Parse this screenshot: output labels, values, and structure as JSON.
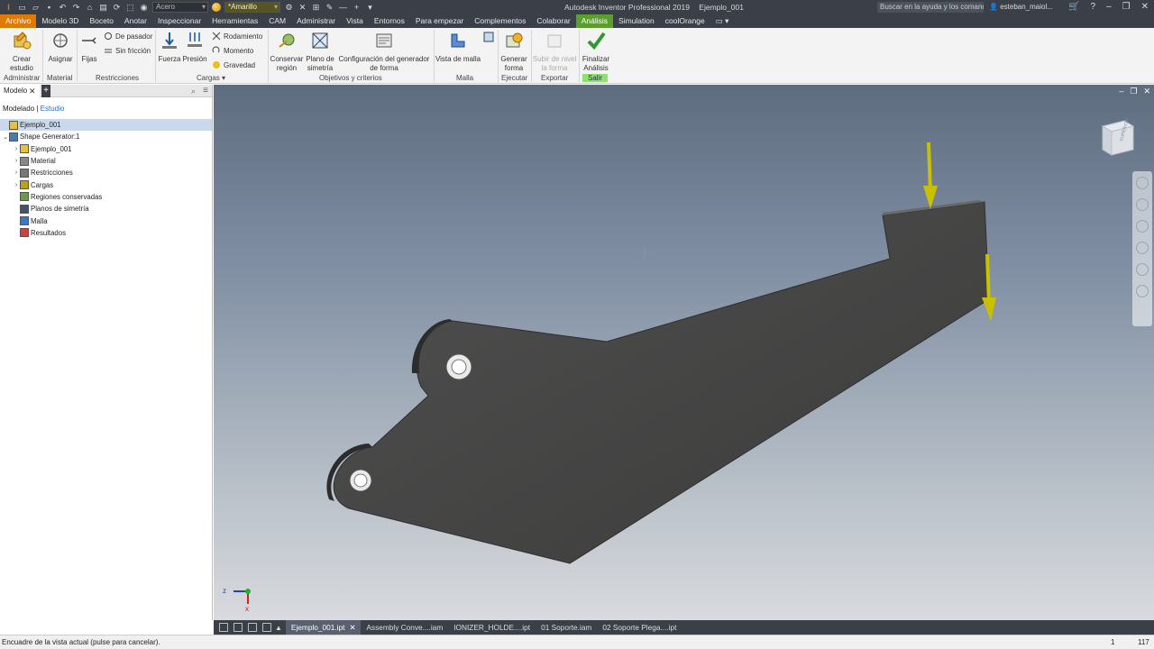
{
  "titlebar": {
    "material": "Acero",
    "appearance": "*Amarillo",
    "app_title": "Autodesk Inventor Professional 2019",
    "doc_title": "Ejemplo_001",
    "search_placeholder": "Buscar en la ayuda y los comandos...",
    "user": "esteban_maiol..."
  },
  "tabs": [
    "Archivo",
    "Modelo 3D",
    "Boceto",
    "Anotar",
    "Inspeccionar",
    "Herramientas",
    "CAM",
    "Administrar",
    "Vista",
    "Entornos",
    "Para empezar",
    "Complementos",
    "Colaborar",
    "Análisis",
    "Simulation",
    "coolOrange"
  ],
  "active_tab": "Análisis",
  "ribbon": {
    "crear_estudio": "Crear estudio",
    "asignar": "Asignar",
    "fijas": "Fijas",
    "de_pasador": "De pasador",
    "sin_friccion": "Sin fricción",
    "fuerza": "Fuerza",
    "presion": "Presión",
    "rodamiento": "Rodamiento",
    "momento": "Momento",
    "gravedad": "Gravedad",
    "conservar_region": "Conservar región",
    "plano_simetria": "Plano de simetría",
    "config_generador": "Configuración del generador de forma",
    "vista_malla": "Vista de malla",
    "generar_forma": "Generar forma",
    "subir_nivel": "Subir de nivel la forma",
    "finalizar": "Finalizar Análisis"
  },
  "groups": {
    "administrar": "Administrar",
    "material": "Material",
    "restricciones": "Restricciones",
    "cargas": "Cargas",
    "objetivos": "Objetivos y criterios",
    "malla": "Malla",
    "ejecutar": "Ejecutar",
    "exportar": "Exportar",
    "salir": "Salir"
  },
  "browser": {
    "tab": "Modelo",
    "mode_modelado": "Modelado",
    "mode_estudio": "Estudio",
    "tree": [
      {
        "label": "Ejemplo_001",
        "level": 0,
        "icon": "part-icon"
      },
      {
        "label": "Shape Generator:1",
        "level": 0,
        "icon": "study-icon",
        "expanded": true
      },
      {
        "label": "Ejemplo_001",
        "level": 1,
        "icon": "part-icon"
      },
      {
        "label": "Material",
        "level": 1,
        "icon": "material-icon"
      },
      {
        "label": "Restricciones",
        "level": 1,
        "icon": "constraint-icon"
      },
      {
        "label": "Cargas",
        "level": 1,
        "icon": "load-icon"
      },
      {
        "label": "Regiones conservadas",
        "level": 1,
        "icon": "region-icon"
      },
      {
        "label": "Planos de simetría",
        "level": 1,
        "icon": "symmetry-icon"
      },
      {
        "label": "Malla",
        "level": 1,
        "icon": "mesh-icon"
      },
      {
        "label": "Resultados",
        "level": 1,
        "icon": "results-icon"
      }
    ]
  },
  "doctabs": [
    "Ejemplo_001.ipt",
    "Assembly Conve....iam",
    "IONIZER_HOLDE....ipt",
    "01 Soporte.iam",
    "02 Soporte Plega....ipt"
  ],
  "status": {
    "message": "Encuadre de la vista actual (pulse para cancelar).",
    "num1": "1",
    "num2": "117"
  },
  "viewcube_label": "SUPERIOR",
  "colors": {
    "file_tab": "#e07a00",
    "active_tab": "#5a9e2e",
    "load_arrow": "#c8c000",
    "part": "#4a4a48"
  }
}
